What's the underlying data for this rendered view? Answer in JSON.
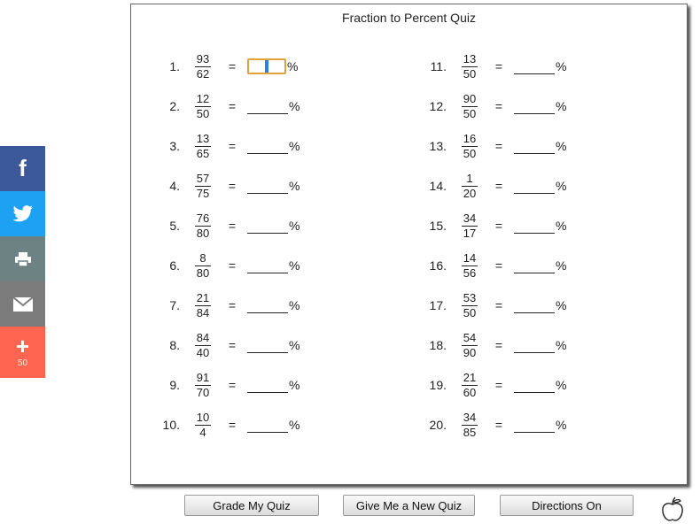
{
  "share": {
    "more_count": "50"
  },
  "quiz": {
    "title": "Fraction to Percent Quiz",
    "equals": "=",
    "percent": "%",
    "questions": [
      {
        "number": "1.",
        "numerator": "93",
        "denominator": "62"
      },
      {
        "number": "2.",
        "numerator": "12",
        "denominator": "50"
      },
      {
        "number": "3.",
        "numerator": "13",
        "denominator": "65"
      },
      {
        "number": "4.",
        "numerator": "57",
        "denominator": "75"
      },
      {
        "number": "5.",
        "numerator": "76",
        "denominator": "80"
      },
      {
        "number": "6.",
        "numerator": "8",
        "denominator": "80"
      },
      {
        "number": "7.",
        "numerator": "21",
        "denominator": "84"
      },
      {
        "number": "8.",
        "numerator": "84",
        "denominator": "40"
      },
      {
        "number": "9.",
        "numerator": "91",
        "denominator": "70"
      },
      {
        "number": "10.",
        "numerator": "10",
        "denominator": "4"
      },
      {
        "number": "11.",
        "numerator": "13",
        "denominator": "50"
      },
      {
        "number": "12.",
        "numerator": "90",
        "denominator": "50"
      },
      {
        "number": "13.",
        "numerator": "16",
        "denominator": "50"
      },
      {
        "number": "14.",
        "numerator": "1",
        "denominator": "20"
      },
      {
        "number": "15.",
        "numerator": "34",
        "denominator": "17"
      },
      {
        "number": "16.",
        "numerator": "14",
        "denominator": "56"
      },
      {
        "number": "17.",
        "numerator": "53",
        "denominator": "50"
      },
      {
        "number": "18.",
        "numerator": "54",
        "denominator": "90"
      },
      {
        "number": "19.",
        "numerator": "21",
        "denominator": "60"
      },
      {
        "number": "20.",
        "numerator": "34",
        "denominator": "85"
      }
    ]
  },
  "buttons": {
    "grade": "Grade My Quiz",
    "new_quiz": "Give Me a New Quiz",
    "directions": "Directions On"
  }
}
